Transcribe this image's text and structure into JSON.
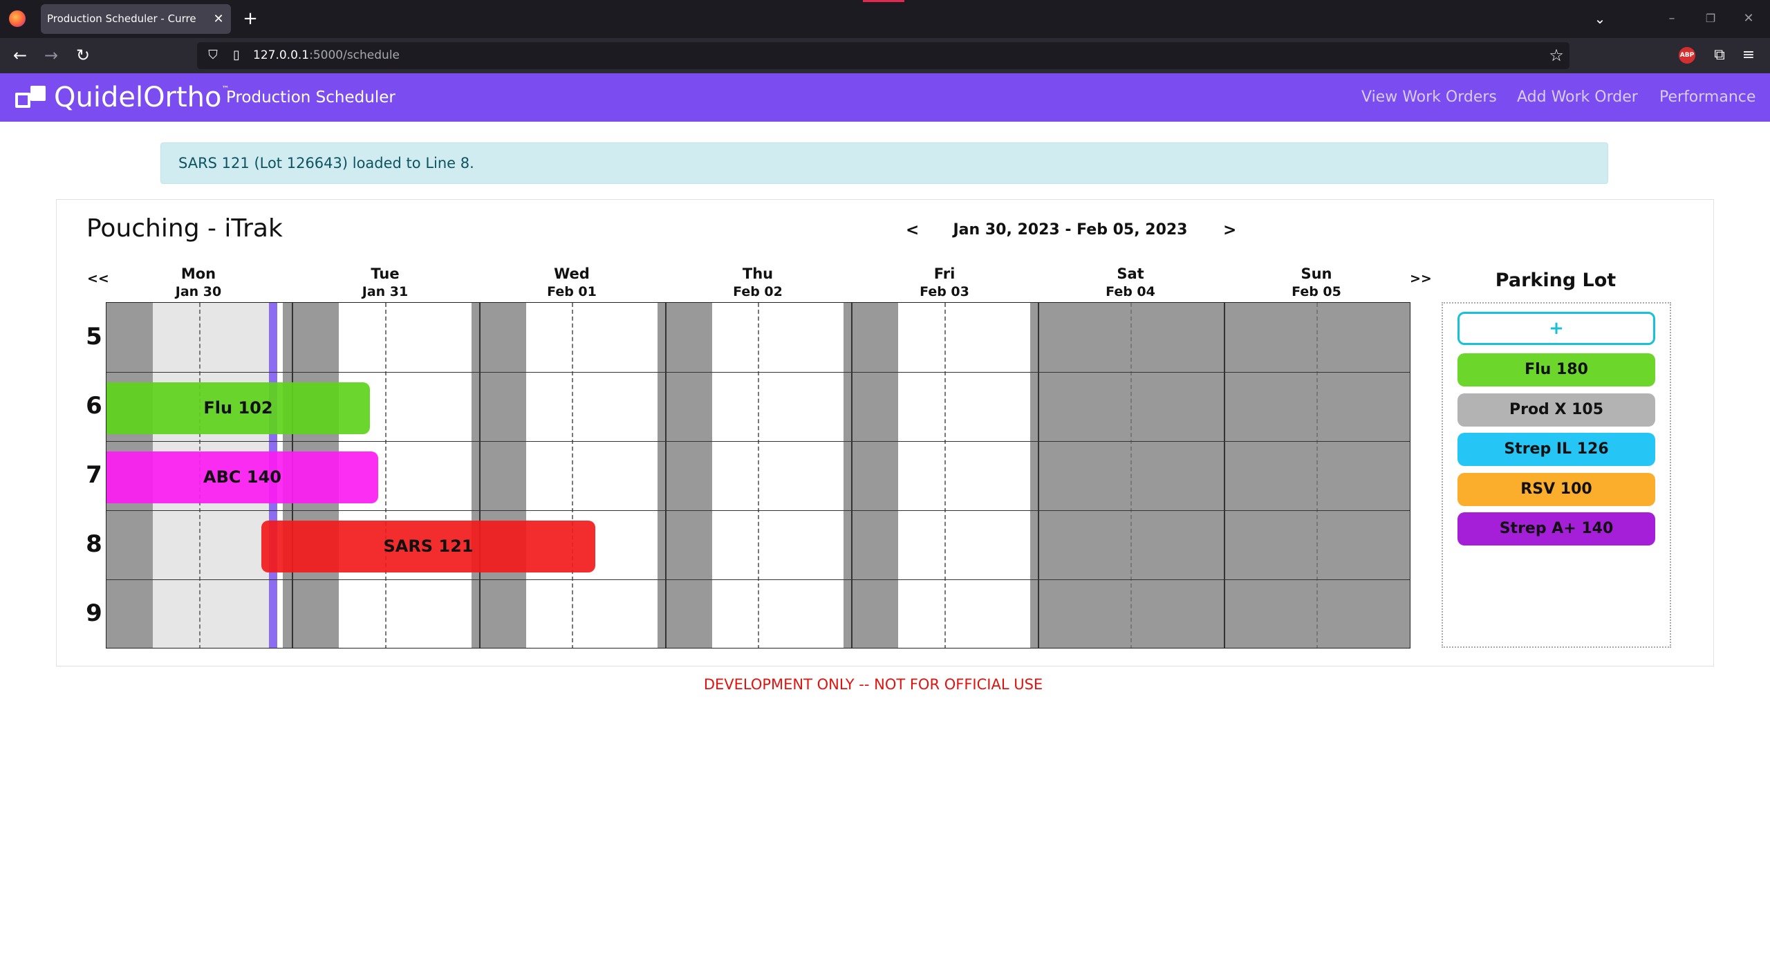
{
  "browser": {
    "tab_title": "Production Scheduler - Current Sche",
    "url_host": "127.0.0.1",
    "url_rest": ":5000/schedule"
  },
  "navbar": {
    "brand": "QuidelOrtho",
    "trademark": "™",
    "app_title": "Production Scheduler",
    "links": [
      "View Work Orders",
      "Add Work Order",
      "Performance"
    ]
  },
  "alert": {
    "message": "SARS 121 (Lot 126643) loaded to Line 8."
  },
  "schedule": {
    "title": "Pouching - iTrak",
    "prev_label": "<",
    "next_label": ">",
    "date_range": "Jan 30, 2023 - Feb 05, 2023",
    "prev_week_label": "<<",
    "next_week_label": ">>",
    "days": [
      {
        "name": "Mon",
        "date": "Jan 30"
      },
      {
        "name": "Tue",
        "date": "Jan 31"
      },
      {
        "name": "Wed",
        "date": "Feb 01"
      },
      {
        "name": "Thu",
        "date": "Feb 02"
      },
      {
        "name": "Fri",
        "date": "Feb 03"
      },
      {
        "name": "Sat",
        "date": "Feb 04"
      },
      {
        "name": "Sun",
        "date": "Feb 05"
      }
    ],
    "lines": [
      "5",
      "6",
      "7",
      "8",
      "9"
    ],
    "work_orders": [
      {
        "label": "Flu 102",
        "line": "6",
        "color": "#5ed21c"
      },
      {
        "label": "ABC 140",
        "line": "7",
        "color": "#fc1cf2"
      },
      {
        "label": "SARS 121",
        "line": "8",
        "color": "#f21b1b"
      }
    ]
  },
  "parking_lot": {
    "title": "Parking Lot",
    "add_label": "+",
    "items": [
      {
        "label": "Flu 180",
        "color": "#6dd62a"
      },
      {
        "label": "Prod X 105",
        "color": "#b3b3b3"
      },
      {
        "label": "Strep IL 126",
        "color": "#25c6f5"
      },
      {
        "label": "RSV 100",
        "color": "#fbae2c"
      },
      {
        "label": "Strep A+ 140",
        "color": "#a61fd8"
      }
    ]
  },
  "footer": {
    "notice": "DEVELOPMENT ONLY -- NOT FOR OFFICIAL USE"
  }
}
